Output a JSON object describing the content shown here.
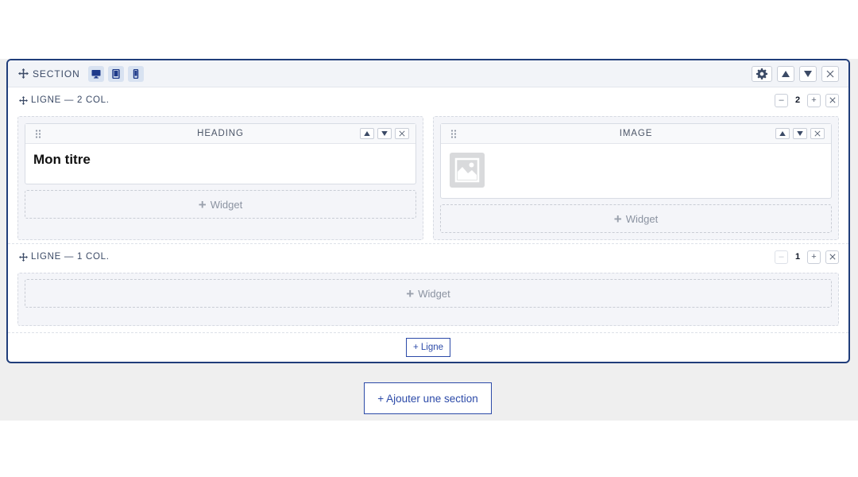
{
  "section": {
    "label": "SECTION",
    "devices": [
      "desktop-icon",
      "tablet-icon",
      "mobile-icon"
    ]
  },
  "rows": [
    {
      "label": "LIGNE — 2 COL.",
      "count": "2",
      "minus": "–",
      "plus": "+",
      "columns": [
        {
          "widget_title": "HEADING",
          "heading_text": "Mon titre",
          "add_label": "Widget"
        },
        {
          "widget_title": "IMAGE",
          "add_label": "Widget"
        }
      ]
    },
    {
      "label": "LIGNE — 1 COL.",
      "count": "1",
      "minus": "–",
      "plus": "+",
      "columns": [
        {
          "add_label": "Widget"
        }
      ]
    }
  ],
  "add_line_label": "+ Ligne",
  "add_section_label": "+ Ajouter une section",
  "colors": {
    "accent": "#2c4aa8",
    "section_border": "#203d7a",
    "canvas_bg": "#efefef"
  }
}
